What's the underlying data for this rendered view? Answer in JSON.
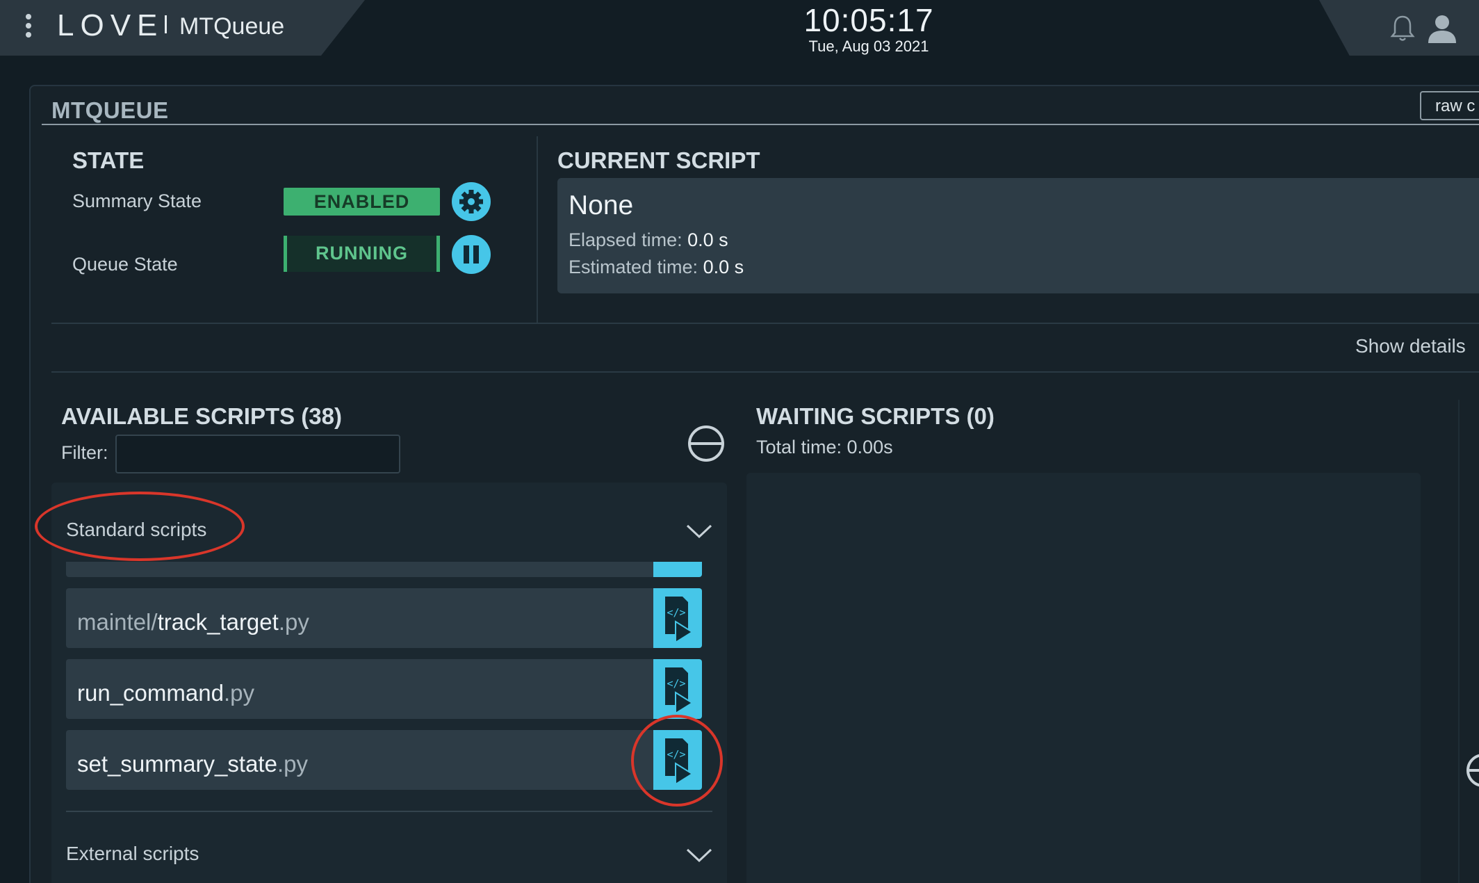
{
  "topbar": {
    "logo": "LOVE",
    "app_name": "MTQueue",
    "time": "10:05:17",
    "date": "Tue, Aug 03 2021"
  },
  "card": {
    "title": "MTQUEUE",
    "raw_button": "raw c"
  },
  "state": {
    "title": "STATE",
    "summary_label": "Summary State",
    "summary_value": "ENABLED",
    "queue_label": "Queue State",
    "queue_value": "RUNNING"
  },
  "current_script": {
    "title": "CURRENT SCRIPT",
    "name": "None",
    "elapsed_label": "Elapsed time: ",
    "elapsed_value": "0.0 s",
    "estimated_label": "Estimated time: ",
    "estimated_value": "0.0 s"
  },
  "show_details": "Show details",
  "available": {
    "title": "AVAILABLE SCRIPTS (38)",
    "filter_label": "Filter:",
    "filter_value": "",
    "standard_group": "Standard scripts",
    "external_group": "External scripts",
    "scripts": [
      {
        "prefix": "maintel/",
        "name": "track_target",
        "ext": ".py"
      },
      {
        "prefix": "",
        "name": "run_command",
        "ext": ".py"
      },
      {
        "prefix": "",
        "name": "set_summary_state",
        "ext": ".py"
      }
    ]
  },
  "waiting": {
    "title": "WAITING SCRIPTS (0)",
    "total_time": "Total time: 0.00s"
  },
  "colors": {
    "accent": "#46c6e8",
    "enabled": "#3db070",
    "annotation": "#d9362a"
  }
}
